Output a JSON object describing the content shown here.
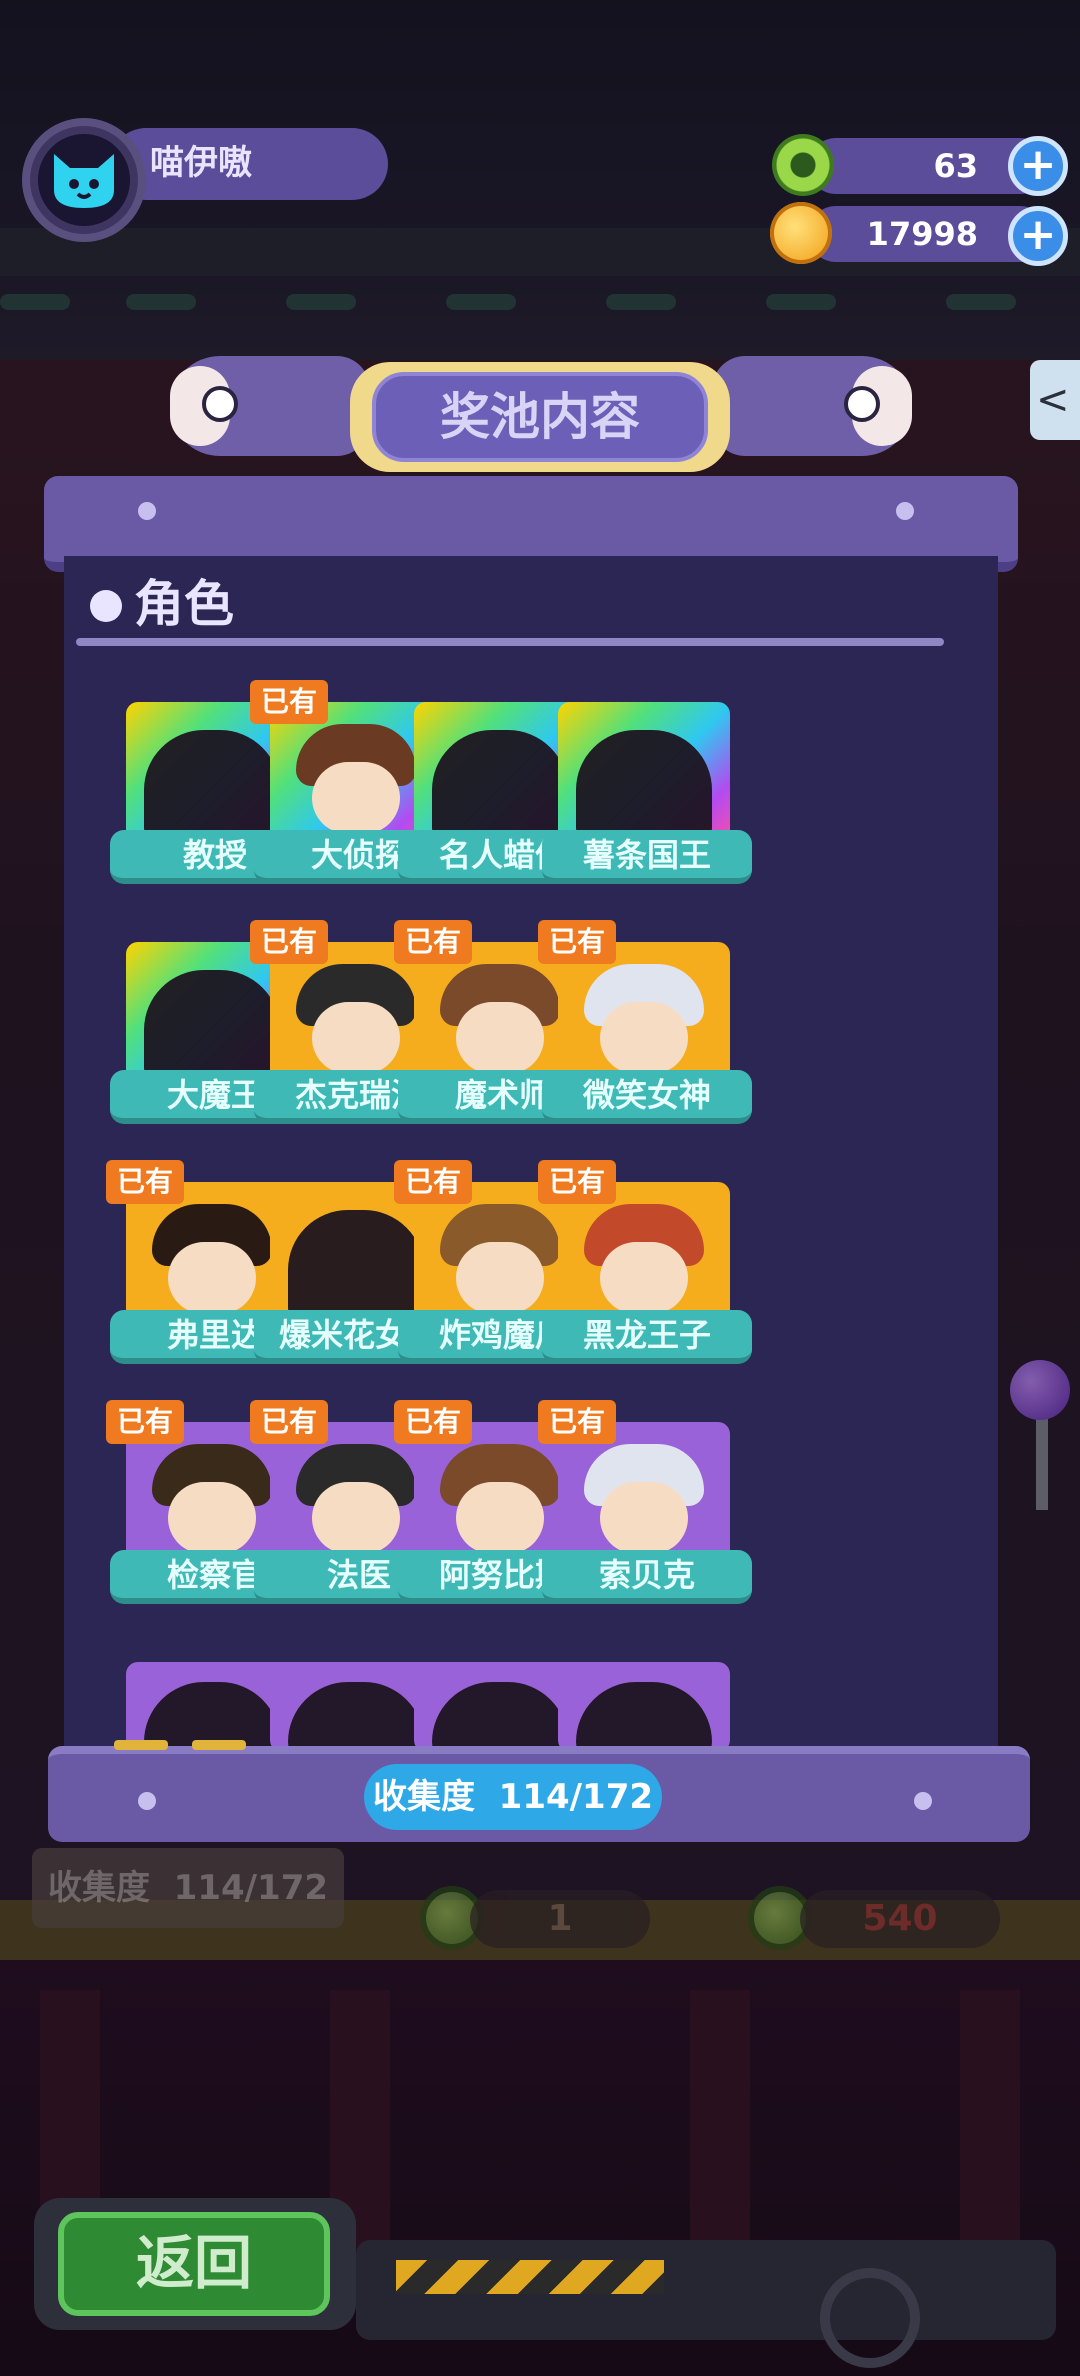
{
  "hud": {
    "player_name": "喵伊嗷",
    "currency_green": {
      "value": "63",
      "icon": "green-donut-coin-icon",
      "plus": "+"
    },
    "currency_gold": {
      "value": "17998",
      "icon": "gold-planet-coin-icon",
      "plus": "+"
    }
  },
  "panel": {
    "title": "奖池内容",
    "section_title": "角色",
    "owned_badge": "已有",
    "progress_label": "收集度",
    "progress_value": "114/172",
    "characters": [
      {
        "name": "教授",
        "owned": false,
        "rarity": "rainbow"
      },
      {
        "name": "大侦探",
        "owned": true,
        "rarity": "rainbow"
      },
      {
        "name": "名人蜡像",
        "owned": false,
        "rarity": "rainbow"
      },
      {
        "name": "薯条国王",
        "owned": false,
        "rarity": "rainbow"
      },
      {
        "name": "大魔王",
        "owned": false,
        "rarity": "rainbow"
      },
      {
        "name": "杰克瑞波",
        "owned": true,
        "rarity": "gold"
      },
      {
        "name": "魔术师",
        "owned": true,
        "rarity": "gold"
      },
      {
        "name": "微笑女神",
        "owned": true,
        "rarity": "gold"
      },
      {
        "name": "弗里达",
        "owned": true,
        "rarity": "gold"
      },
      {
        "name": "爆米花女王",
        "owned": false,
        "rarity": "gold"
      },
      {
        "name": "炸鸡魔后",
        "owned": true,
        "rarity": "gold"
      },
      {
        "name": "黑龙王子",
        "owned": true,
        "rarity": "gold"
      },
      {
        "name": "检察官",
        "owned": true,
        "rarity": "purple"
      },
      {
        "name": "法医",
        "owned": true,
        "rarity": "purple"
      },
      {
        "name": "阿努比斯",
        "owned": true,
        "rarity": "purple"
      },
      {
        "name": "索贝克",
        "owned": true,
        "rarity": "purple"
      }
    ]
  },
  "background": {
    "collect_label": "收集度",
    "collect_value": "114/172",
    "ticket_count": "1",
    "price": "540"
  },
  "back_button": "返回",
  "colors": {
    "panel": "#2c2654",
    "panel_frame": "#6a5aa6",
    "label_teal": "#3fb9b6",
    "owned_orange": "#f07a20",
    "progress_blue": "#2fa8e8",
    "back_green": "#2f8a34"
  }
}
